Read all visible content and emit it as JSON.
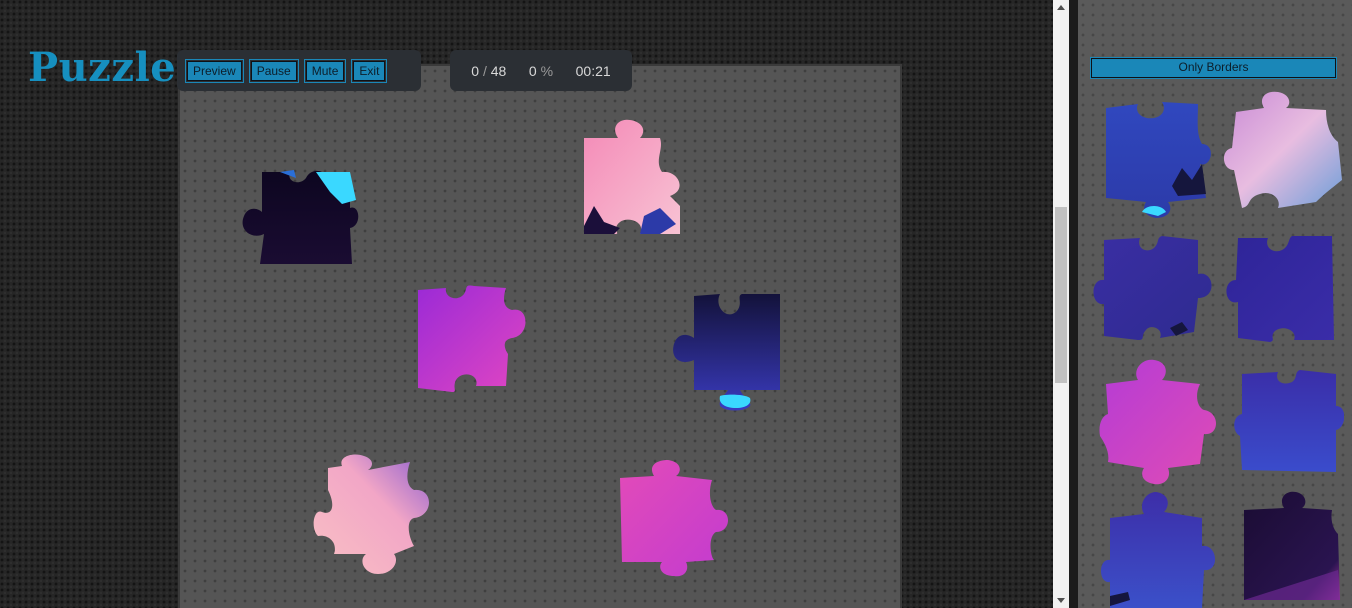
{
  "app": {
    "title": "Puzzle"
  },
  "toolbar": {
    "preview_label": "Preview",
    "pause_label": "Pause",
    "mute_label": "Mute",
    "exit_label": "Exit"
  },
  "stats": {
    "placed": "0",
    "separator": "/",
    "total": "48",
    "percent": "0",
    "percent_sign": "%",
    "timer": "00:21"
  },
  "tray": {
    "filter_label": "Only Borders"
  },
  "colors": {
    "accent": "#1a87b8",
    "logo": "#168fbf",
    "piece_pink": "#f3a3c4",
    "piece_magenta": "#c93bcf",
    "piece_navy": "#2a2590",
    "piece_blue": "#2f4ec7",
    "piece_dark": "#150a2a",
    "piece_cyan": "#3ad8ff"
  },
  "board_pieces": [
    {
      "name": "piece-dark-cyan",
      "colors": [
        "#0d0620",
        "#1a0c32"
      ]
    },
    {
      "name": "piece-pink-top",
      "colors": [
        "#f48ab7",
        "#f6b7cf"
      ]
    },
    {
      "name": "piece-purple",
      "colors": [
        "#a42bd6",
        "#e045c3"
      ]
    },
    {
      "name": "piece-navy-cyan",
      "colors": [
        "#161642",
        "#3a3bbf"
      ]
    },
    {
      "name": "piece-peach",
      "colors": [
        "#f6b7bf",
        "#a672c9"
      ]
    },
    {
      "name": "piece-magenta",
      "colors": [
        "#e34bb8",
        "#c23bd0"
      ]
    }
  ],
  "tray_pieces": [
    {
      "name": "tray-piece-blue",
      "colors": [
        "#3048bf",
        "#2c3aa8"
      ]
    },
    {
      "name": "tray-piece-lavender",
      "colors": [
        "#b381d6",
        "#6d9ed8"
      ]
    },
    {
      "name": "tray-piece-indigo-1",
      "colors": [
        "#3a2ea3",
        "#2e2b90"
      ]
    },
    {
      "name": "tray-piece-indigo-2",
      "colors": [
        "#2e2498",
        "#3a2da8"
      ]
    },
    {
      "name": "tray-piece-magenta",
      "colors": [
        "#b43bd6",
        "#e04cb5"
      ]
    },
    {
      "name": "tray-piece-indigo-3",
      "colors": [
        "#3a2ea8",
        "#3a4ccc"
      ]
    },
    {
      "name": "tray-piece-indigo-4",
      "colors": [
        "#3d2ea8",
        "#3b50c9"
      ]
    },
    {
      "name": "tray-piece-dark",
      "colors": [
        "#1a0c32",
        "#3b1c63"
      ]
    }
  ]
}
